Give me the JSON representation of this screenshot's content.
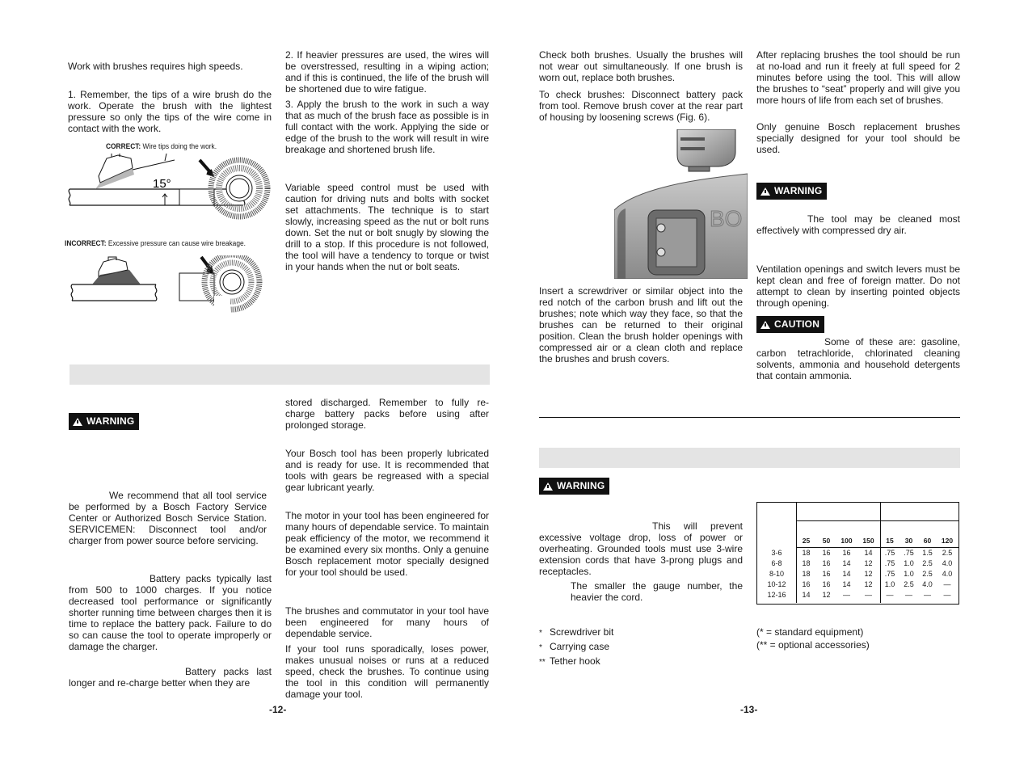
{
  "page12": {
    "col1": {
      "p_speed": "Work with brushes requires high speeds.",
      "p_tips": "1. Remember, the tips of a wire brush do the work. Operate the brush with the lightest pressure so only the tips of the wire come in contact with the work.",
      "fig_correct": {
        "label": "CORRECT:",
        "text": "Wire tips doing the work.",
        "angle": "15°"
      },
      "fig_incorrect": {
        "label": "INCORRECT:",
        "text": "Excessive pressure can cause wire breakage."
      }
    },
    "col2": {
      "p_heavier": "2. If heavier pressures are used, the wires will be overstressed, resulting in a wiping action; and if this is continued, the life of the brush will be shortened due to wire fatigue.",
      "p_apply": "3. Apply the brush to the work in such a way that as much of the brush face as possible is in full contact with the work. Applying the side or edge of the brush to the work will result in wire breakage and shortened brush life.",
      "p_variable": "Variable speed control must be used with caution for driving nuts and bolts with socket set attachments. The technique is to start slowly, increasing speed as the nut or bolt runs down. Set the nut or bolt snugly by slowing the drill to a stop. If this procedure is not followed, the tool will have a tendency to torque or twist in your hands when the nut or bolt seats."
    },
    "lower_col1": {
      "warning_label": "WARNING",
      "p_service": "We recommend that all tool service be performed by a Bosch Factory Service Center or Authorized Bosch Service Station. SERVICEMEN: Disconnect tool and/or charger from power source before servicing.",
      "p_battery_life": "Battery packs typically last from 500 to 1000 charges.  If you notice decreased tool performance or significantly shorter running time between charges then it is time to replace the battery pack.  Failure to do so can cause the tool to operate improperly or damage the charger.",
      "p_battery_store": "Battery packs last longer and re-charge better when they are"
    },
    "lower_col2": {
      "p_store_cont": "stored discharged.  Remember to fully re-charge battery packs before using after prolonged storage.",
      "p_lube": "Your Bosch tool has been properly lubricated and is ready for use. It is recommended that tools with gears be regreased with a special gear lubricant yearly.",
      "p_motor": "The motor in your tool has been engineered for many hours of dependable service. To maintain peak efficiency of the motor, we recommend it be examined every six months. Only a genuine Bosch replacement motor specially designed for your tool should be used.",
      "p_brushes": "The brushes and commutator in your tool have been engineered for many hours of dependable service.",
      "p_sporadic": "If your tool runs sporadically, loses power, makes unusual noises or runs at a reduced speed, check the brushes. To continue using the tool in this condition will permanently damage your tool."
    },
    "page_number": "-12-"
  },
  "page13": {
    "col1": {
      "p_check": "Check both brushes. Usually the brushes will not wear out simultaneously. If one brush is worn out, replace both brushes.",
      "p_tocheck": "To check brushes: Disconnect battery pack from tool. Remove brush cover at the rear part of housing by loosening screws (Fig. 6).",
      "fig_brand_text": "BO",
      "p_insert": "Insert a screwdriver or similar object into the red notch of the carbon brush and lift out the brushes; note which way they face, so that the brushes can be returned to their original position.  Clean the brush holder openings with compressed air or a clean cloth and replace the brushes and brush covers."
    },
    "col2": {
      "p_after": "After replacing brushes the tool should be run at no-load and run it freely at full speed for 2 minutes before using the tool. This will allow the brushes to “seat” properly and will give you more hours of life from each set of brushes.",
      "p_genuine": "Only genuine Bosch replacement brushes specially designed for your tool should be used.",
      "warning_label": "WARNING",
      "p_clean": "The tool may be cleaned most effectively with compressed dry air.",
      "p_vent": "Ventilation openings and switch levers must be kept clean and free of foreign matter. Do not attempt to clean by inserting pointed objects through opening.",
      "caution_label": "CAUTION",
      "p_solvents": "Some of these are: gasoline, carbon tetrachloride, chlorinated cleaning solvents, ammonia and household detergents that contain ammonia."
    },
    "ext": {
      "warning_label": "WARNING",
      "p_prevent": "This will prevent excessive voltage drop, loss of power or overheating.  Grounded tools must use 3-wire extension cords that have 3-prong plugs and receptacles.",
      "p_gauge": "The smaller the gauge number, the heavier the cord.",
      "table": {
        "ft_headers": [
          "25",
          "50",
          "100",
          "150"
        ],
        "m_headers": [
          "15",
          "30",
          "60",
          "120"
        ],
        "rows": [
          {
            "amps": "3-6",
            "awg": [
              "18",
              "16",
              "16",
              "14"
            ],
            "mm2": [
              ".75",
              ".75",
              "1.5",
              "2.5"
            ]
          },
          {
            "amps": "6-8",
            "awg": [
              "18",
              "16",
              "14",
              "12"
            ],
            "mm2": [
              ".75",
              "1.0",
              "2.5",
              "4.0"
            ]
          },
          {
            "amps": "8-10",
            "awg": [
              "18",
              "16",
              "14",
              "12"
            ],
            "mm2": [
              ".75",
              "1.0",
              "2.5",
              "4.0"
            ]
          },
          {
            "amps": "10-12",
            "awg": [
              "16",
              "16",
              "14",
              "12"
            ],
            "mm2": [
              "1.0",
              "2.5",
              "4.0",
              "—"
            ]
          },
          {
            "amps": "12-16",
            "awg": [
              "14",
              "12",
              "—",
              "—"
            ],
            "mm2": [
              "—",
              "—",
              "—",
              "—"
            ]
          }
        ]
      }
    },
    "accessories": {
      "items": [
        {
          "mark": "*",
          "label": "Screwdriver bit"
        },
        {
          "mark": "*",
          "label": "Carrying case"
        },
        {
          "mark": "**",
          "label": "Tether hook"
        }
      ],
      "legend": [
        "(* = standard equipment)",
        "(** = optional accessories)"
      ]
    },
    "page_number": "-13-"
  }
}
